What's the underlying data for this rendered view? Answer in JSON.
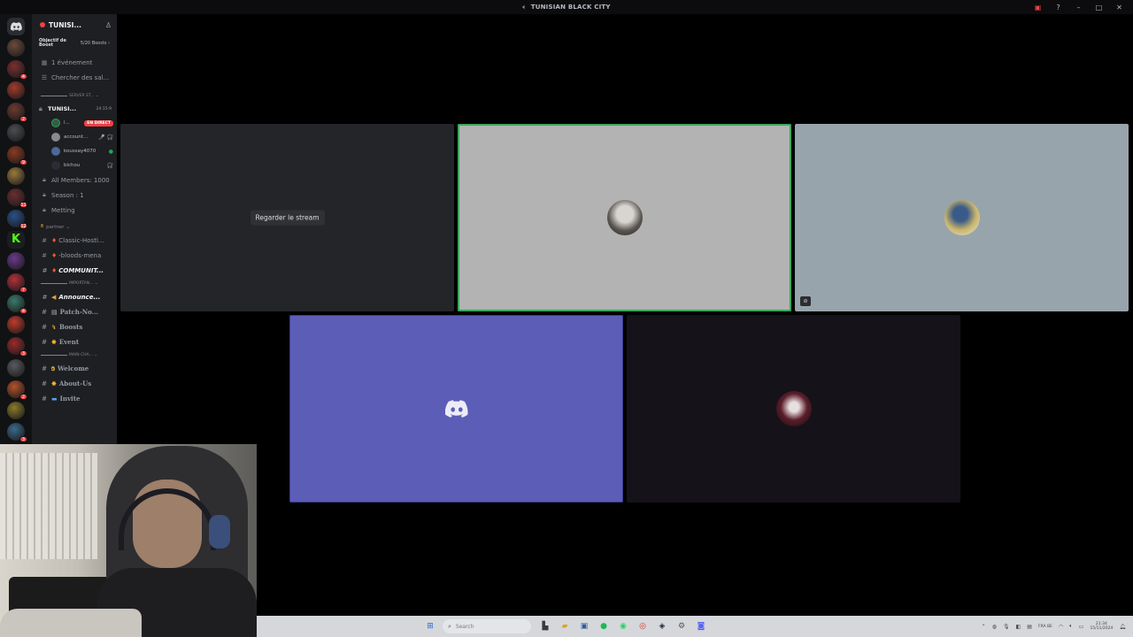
{
  "window": {
    "title": "TUNISIAN BLACK CITY",
    "title_icon": "speaker-icon"
  },
  "server_rail": {
    "home_icon": "discord-logo-icon",
    "servers": [
      {
        "color": "#6b4a3a",
        "badge": ""
      },
      {
        "color": "#7a3030",
        "badge": "4"
      },
      {
        "color": "#a33b2c",
        "badge": ""
      },
      {
        "color": "#6d3a2f",
        "badge": "2"
      },
      {
        "color": "#4d4d52",
        "badge": ""
      },
      {
        "color": "#8a3a20",
        "badge": "9"
      },
      {
        "color": "#9a7a3a",
        "badge": ""
      },
      {
        "color": "#6b2f2f",
        "badge": "11"
      },
      {
        "color": "#2b4f8a",
        "badge": "12"
      },
      {
        "color": "#kick",
        "badge": ""
      },
      {
        "color": "#6a3a8a",
        "badge": ""
      },
      {
        "color": "#b3303a",
        "badge": "7"
      },
      {
        "color": "#3a7a6a",
        "badge": "4"
      },
      {
        "color": "#c23a2a",
        "badge": ""
      },
      {
        "color": "#9a2a2a",
        "badge": "3"
      },
      {
        "color": "#5a5a5e",
        "badge": ""
      },
      {
        "color": "#b5522a",
        "badge": "2"
      },
      {
        "color": "#8a7a2a",
        "badge": ""
      },
      {
        "color": "#3a6a8a",
        "badge": "3"
      },
      {
        "color": "#2f3136",
        "badge": ""
      }
    ]
  },
  "guild": {
    "name": "TUNISI...",
    "boost_label": "Objectif de Boost",
    "boost_count": "5/20 Boosts ›",
    "event": "1 événement",
    "search_channels": "Chercher des sal..."
  },
  "channels": {
    "cat_server": "SERVER ST...",
    "voice_channel": "TUNISI...",
    "voice_time": "24:15:9",
    "voice_users": [
      {
        "name": "l...",
        "live": "EN DIRECT",
        "status": "",
        "avatar_color": "#3b5a44"
      },
      {
        "name": "account...",
        "live": "",
        "status": "🎤̸ 🎧̸",
        "avatar_color": "#8a8a8a"
      },
      {
        "name": "koussay4070",
        "live": "",
        "status": "●",
        "avatar_color": "#4a6a9a"
      },
      {
        "name": "bichou",
        "live": "",
        "status": "🎧̸",
        "avatar_color": "#2f2b36"
      }
    ],
    "all_members": "All Members: 1000",
    "season": "Season : 1",
    "metting": "Metting",
    "cat_partner": "partner",
    "classic": "Classic-Hosti...",
    "bloods": "-bloods-mena",
    "communit": "COMMUNIT...",
    "cat_important": "IMPORTAN...",
    "announce": "Announce...",
    "patch": "Patch-No...",
    "boosts": "Boosts",
    "event": "Event",
    "cat_main": "MAIN CHA...",
    "welcome": "Welcome",
    "about": "About-Us",
    "invite": "Invite"
  },
  "stage": {
    "watch_stream": "Regarder le stream",
    "tile2_avatar_color": "#5a5550",
    "tile3_avatar_color": "#c9b56a",
    "tile5_avatar_color": "#5b1e2a"
  },
  "taskbar": {
    "search_placeholder": "Search",
    "lang": "FRA BE",
    "time": "21:34",
    "date": "15/11/2024"
  }
}
